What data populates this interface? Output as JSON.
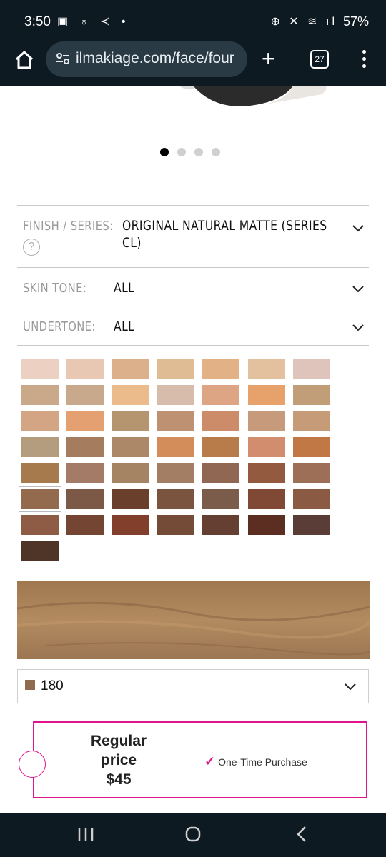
{
  "status_bar": {
    "time": "3:50",
    "left_icons": [
      "image-icon",
      "bluetooth-icon",
      "nfc-icon",
      "dot-icon"
    ],
    "battery": "57%"
  },
  "browser": {
    "url": "ilmakiage.com/face/four",
    "tab_count": "27"
  },
  "carousel": {
    "dot_count": 4,
    "active_index": 0
  },
  "filters": {
    "finish": {
      "label": "FINISH / SERIES:",
      "value": "ORIGINAL NATURAL MATTE (SERIES CL)"
    },
    "skin_tone": {
      "label": "SKIN  TONE:",
      "value": "ALL"
    },
    "undertone": {
      "label": "UNDERTONE:",
      "value": "ALL"
    }
  },
  "swatch_colors": [
    [
      "#ecd0c1",
      "#e8c7b3",
      "#dbb08a",
      "#e0bc95",
      "#e2b286",
      "#e3c19f",
      "#dec4ba"
    ],
    [
      "#c9a989",
      "#c9a98c",
      "#ebbb8c",
      "#d8bcab",
      "#dea584",
      "#e7a16b",
      "#c29e78"
    ],
    [
      "#d4a584",
      "#e5a071",
      "#b59470",
      "#bf9173",
      "#cc8b69",
      "#c79a7c",
      "#c69b78"
    ],
    [
      "#b49c7f",
      "#a57c5d",
      "#ad8868",
      "#d28d5a",
      "#b87b4a",
      "#d18d6e",
      "#c27845"
    ],
    [
      "#a77a4e",
      "#a37b67",
      "#a48463",
      "#a37e65",
      "#906752",
      "#945a40",
      "#9c6f56"
    ],
    [
      "#936a4d",
      "#7c5946",
      "#6a3f2c",
      "#7b5440",
      "#7b5c4a",
      "#7f4935",
      "#8a5a43"
    ],
    [
      "#8e5c45",
      "#734532",
      "#823f2c",
      "#744b37",
      "#653f31",
      "#5c2e22",
      "#5a3d36"
    ],
    [
      "#4e3528"
    ]
  ],
  "selected_swatch": {
    "row": 5,
    "col": 0
  },
  "shade_dropdown": {
    "chip_color": "#8f6a4e",
    "value": "180"
  },
  "purchase": {
    "price_label_1": "Regular",
    "price_label_2": "price",
    "price": "$45",
    "option": "One-Time Purchase",
    "accent": "#e0158a"
  }
}
